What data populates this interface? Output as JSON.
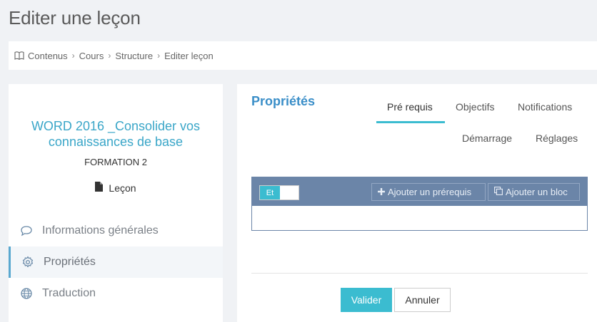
{
  "page": {
    "title": "Editer une leçon"
  },
  "breadcrumb": {
    "icon": "book-icon",
    "items": [
      "Contenus",
      "Cours",
      "Structure",
      "Editer leçon"
    ]
  },
  "course": {
    "title": "WORD 2016 _Consolider vos connaissances de base",
    "subtitle": "FORMATION 2",
    "type_icon": "file-icon",
    "type": "Leçon"
  },
  "sidebar": {
    "items": [
      {
        "label": "Informations générales",
        "icon": "comment-icon"
      },
      {
        "label": "Propriétés",
        "icon": "gear-icon",
        "active": true
      },
      {
        "label": "Traduction",
        "icon": "globe-icon"
      }
    ]
  },
  "panel": {
    "heading": "Propriétés",
    "tabs": [
      {
        "label": "Pré requis",
        "active": true
      },
      {
        "label": "Objectifs"
      },
      {
        "label": "Notifications"
      },
      {
        "label": "Démarrage"
      },
      {
        "label": "Réglages"
      }
    ]
  },
  "prereq": {
    "toggle_label": "Et",
    "add_prereq_label": "Ajouter un prérequis",
    "add_block_label": "Ajouter un bloc"
  },
  "actions": {
    "submit_label": "Valider",
    "cancel_label": "Annuler"
  },
  "colors": {
    "accent": "#3bbcd0",
    "heading_blue": "#3a8ec8",
    "toolbar": "#6b85a8"
  }
}
